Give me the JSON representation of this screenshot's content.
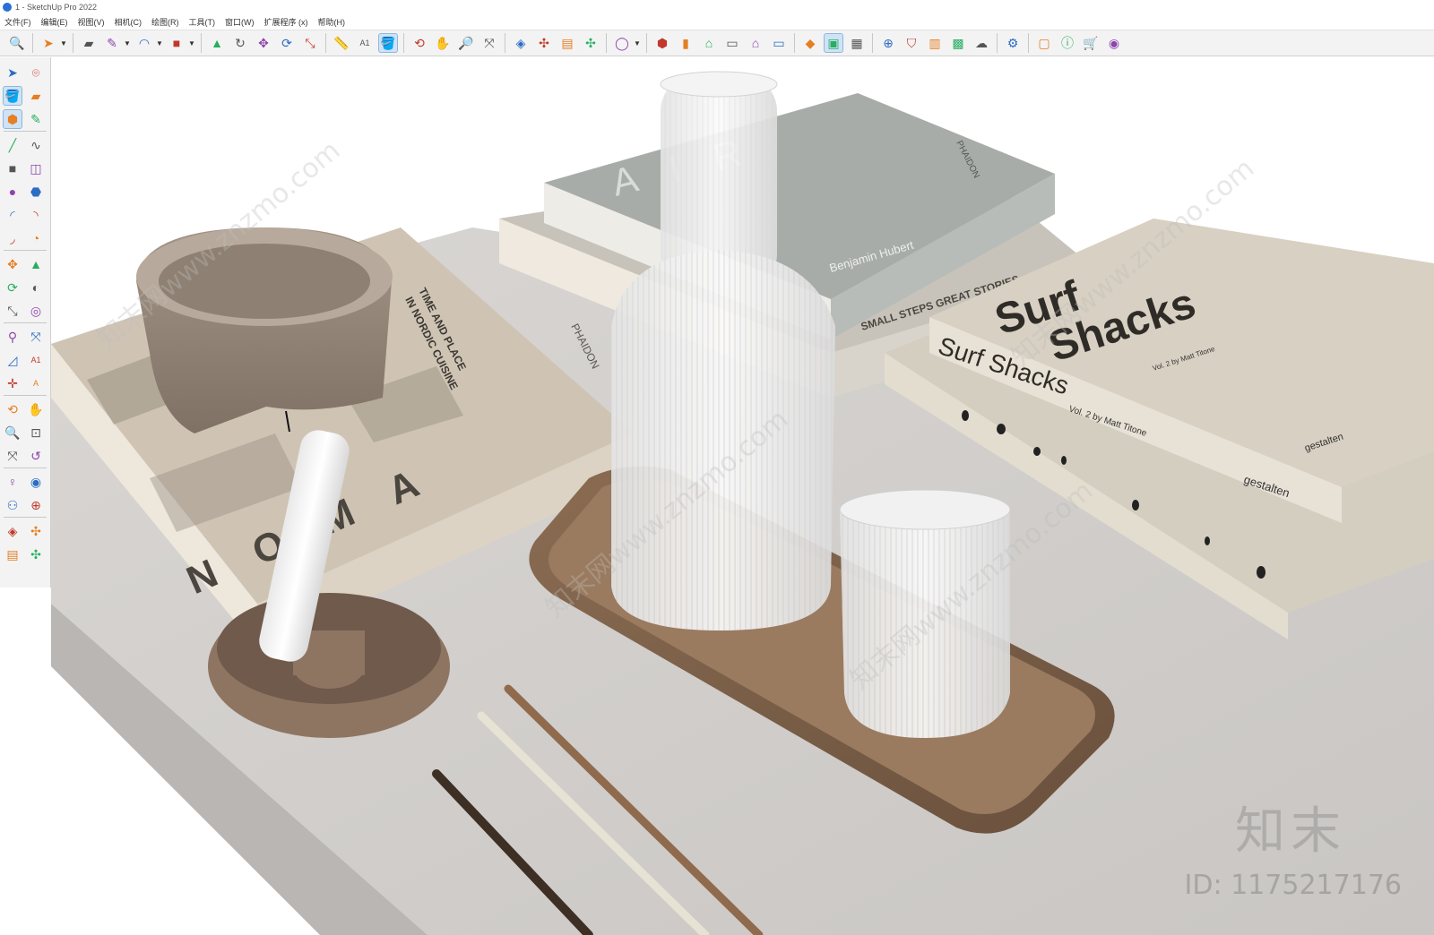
{
  "window": {
    "title": "1 - SketchUp Pro 2022"
  },
  "menu": [
    "文件(F)",
    "编辑(E)",
    "视图(V)",
    "相机(C)",
    "绘图(R)",
    "工具(T)",
    "窗口(W)",
    "扩展程序 (x)",
    "帮助(H)"
  ],
  "toolbar": {
    "tools": [
      {
        "name": "zoom-icon",
        "glyph": "🔍"
      },
      {
        "sep": true
      },
      {
        "name": "select-icon",
        "glyph": "➤",
        "caret": true
      },
      {
        "sep": true
      },
      {
        "name": "eraser-icon",
        "glyph": "▰"
      },
      {
        "name": "pencil-line-icon",
        "glyph": "✎",
        "caret": true
      },
      {
        "name": "arc-icon",
        "glyph": "◠",
        "caret": true
      },
      {
        "name": "rectangle-icon",
        "glyph": "■",
        "caret": true
      },
      {
        "sep": true
      },
      {
        "name": "pushpull-icon",
        "glyph": "▲"
      },
      {
        "name": "followme-icon",
        "glyph": "↻"
      },
      {
        "name": "move-icon",
        "glyph": "✥"
      },
      {
        "name": "rotate-icon",
        "glyph": "⟳"
      },
      {
        "name": "scale-icon",
        "glyph": "⤡"
      },
      {
        "sep": true
      },
      {
        "name": "tape-measure-icon",
        "glyph": "📏"
      },
      {
        "name": "text-icon",
        "glyph": "A1"
      },
      {
        "name": "paint-bucket-icon",
        "glyph": "🪣",
        "active": true
      },
      {
        "sep": true
      },
      {
        "name": "orbit-icon",
        "glyph": "⟲"
      },
      {
        "name": "pan-icon",
        "glyph": "✋"
      },
      {
        "name": "zoom-window-icon",
        "glyph": "🔎"
      },
      {
        "name": "zoom-extents-icon",
        "glyph": "⤧"
      },
      {
        "sep": true
      },
      {
        "name": "warehouse-icon",
        "glyph": "◈"
      },
      {
        "name": "extension-warehouse-icon",
        "glyph": "✣"
      },
      {
        "name": "layout-icon",
        "glyph": "▤"
      },
      {
        "name": "extension-manager-icon",
        "glyph": "✣"
      },
      {
        "sep": true
      },
      {
        "name": "user-icon",
        "glyph": "◯",
        "caret": true
      },
      {
        "sep": true
      },
      {
        "name": "iso-view-icon",
        "glyph": "⬢"
      },
      {
        "name": "side-view-icon",
        "glyph": "▮"
      },
      {
        "name": "front-view-icon",
        "glyph": "⌂"
      },
      {
        "name": "top-view-icon",
        "glyph": "▭"
      },
      {
        "name": "right-view-icon",
        "glyph": "⌂"
      },
      {
        "name": "back-view-icon",
        "glyph": "▭"
      },
      {
        "sep": true
      },
      {
        "name": "solid-tools-icon",
        "glyph": "◆"
      },
      {
        "name": "section-plane-icon",
        "glyph": "▣",
        "active": true
      },
      {
        "name": "outliner-icon",
        "glyph": "▦"
      },
      {
        "sep": true
      },
      {
        "name": "add-location-icon",
        "glyph": "⊕"
      },
      {
        "name": "shield-icon",
        "glyph": "⛉"
      },
      {
        "name": "styles-icon",
        "glyph": "▥"
      },
      {
        "name": "checker-icon",
        "glyph": "▩"
      },
      {
        "name": "cloud-upload-icon",
        "glyph": "☁"
      },
      {
        "sep": true
      },
      {
        "name": "settings-icon",
        "glyph": "⚙"
      },
      {
        "sep": true
      },
      {
        "name": "window-icon",
        "glyph": "▢"
      },
      {
        "name": "info-icon",
        "glyph": "ⓘ"
      },
      {
        "name": "cart-icon",
        "glyph": "🛒"
      },
      {
        "name": "account-icon",
        "glyph": "◉"
      }
    ]
  },
  "lefttools": {
    "rows": [
      [
        {
          "name": "select-icon",
          "glyph": "➤"
        },
        {
          "name": "lasso-icon",
          "glyph": "⌾"
        }
      ],
      [
        {
          "name": "paint-bucket-icon",
          "glyph": "🪣",
          "active": true
        },
        {
          "name": "eraser-icon",
          "glyph": "▰"
        }
      ],
      [
        {
          "name": "make-component-icon",
          "glyph": "⬢",
          "active": true
        },
        {
          "name": "tag-icon",
          "glyph": "✎"
        }
      ],
      [
        {
          "name": "line-icon",
          "glyph": "╱"
        },
        {
          "name": "freehand-icon",
          "glyph": "∿"
        }
      ],
      [
        {
          "name": "rectangle-icon",
          "glyph": "■"
        },
        {
          "name": "rotated-rect-icon",
          "glyph": "◫"
        }
      ],
      [
        {
          "name": "circle-icon",
          "glyph": "●"
        },
        {
          "name": "polygon-icon",
          "glyph": "⬣"
        }
      ],
      [
        {
          "name": "arc-icon",
          "glyph": "◜"
        },
        {
          "name": "two-point-arc-icon",
          "glyph": "◝"
        }
      ],
      [
        {
          "name": "three-point-arc-icon",
          "glyph": "◞"
        },
        {
          "name": "pie-icon",
          "glyph": "◔"
        }
      ],
      [
        {
          "name": "move-icon",
          "glyph": "✥"
        },
        {
          "name": "pushpull-icon",
          "glyph": "▲"
        }
      ],
      [
        {
          "name": "rotate-icon",
          "glyph": "⟳"
        },
        {
          "name": "followme-icon",
          "glyph": "◐"
        }
      ],
      [
        {
          "name": "scale-icon",
          "glyph": "⤡"
        },
        {
          "name": "offset-icon",
          "glyph": "◎"
        }
      ],
      [
        {
          "name": "tape-measure-icon",
          "glyph": "⚲"
        },
        {
          "name": "dimension-icon",
          "glyph": "⤧"
        }
      ],
      [
        {
          "name": "protractor-icon",
          "glyph": "◿"
        },
        {
          "name": "text-icon",
          "glyph": "A1"
        }
      ],
      [
        {
          "name": "axes-icon",
          "glyph": "✛"
        },
        {
          "name": "3d-text-icon",
          "glyph": "A"
        }
      ],
      [
        {
          "name": "orbit-icon",
          "glyph": "⟲"
        },
        {
          "name": "pan-icon",
          "glyph": "✋"
        }
      ],
      [
        {
          "name": "zoom-icon",
          "glyph": "🔍"
        },
        {
          "name": "zoom-window-icon",
          "glyph": "⊡"
        }
      ],
      [
        {
          "name": "zoom-extents-icon",
          "glyph": "⤧"
        },
        {
          "name": "previous-view-icon",
          "glyph": "↺"
        }
      ],
      [
        {
          "name": "position-camera-icon",
          "glyph": "♀"
        },
        {
          "name": "look-around-icon",
          "glyph": "◉"
        }
      ],
      [
        {
          "name": "walk-icon",
          "glyph": "⚇"
        },
        {
          "name": "section-plane-icon",
          "glyph": "⊕"
        }
      ],
      [
        {
          "name": "warehouse-icon",
          "glyph": "◈"
        },
        {
          "name": "extension-warehouse-icon",
          "glyph": "✣"
        }
      ],
      [
        {
          "name": "layout-icon",
          "glyph": "▤"
        },
        {
          "name": "extension-manager-icon",
          "glyph": "✣"
        }
      ]
    ]
  },
  "scene": {
    "book_nuoma_lines": [
      "TIME AND PLACE",
      "IN NORDIC CUISINE"
    ],
    "book_nuoma_publisher": "PHAIDON",
    "book_nuoma_spine": "N O M A",
    "book_grey_spine_author": "Benjamin Hubert",
    "book_grey_publisher": "PHAIDON",
    "book_grey_big": "A I R",
    "book_stories_spine": "SMALL STEPS GREAT STORIES",
    "book_surf_title_1": "Surf",
    "book_surf_title_2": "Shacks",
    "book_surf_cover_small": "Vol. 2  by Matt Titone",
    "book_surf_spine": "Surf Shacks",
    "book_surf_spine_vol": "Vol. 2   by Matt Titone",
    "book_surf_spine_pub": "gestalten",
    "book_surf_cover_pub": "gestalten"
  },
  "watermark": {
    "logo": "知末",
    "id": "ID: 1175217176",
    "diag": "知末网www.znzmo.com"
  }
}
